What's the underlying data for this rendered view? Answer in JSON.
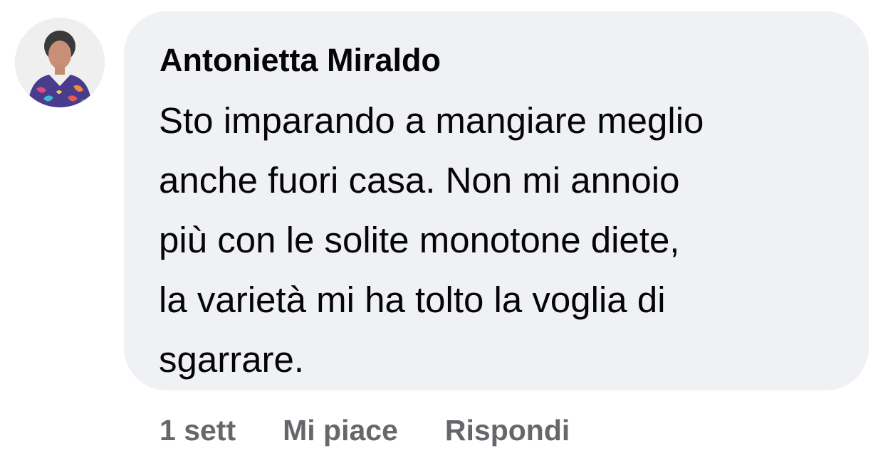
{
  "comment": {
    "author": "Antonietta Miraldo",
    "avatar_icon": "profile-photo-icon",
    "text_lines": [
      "Sto imparando a mangiare meglio",
      "anche fuori casa. Non mi annoio",
      "più con le solite monotone diete,",
      "la varietà mi ha tolto la voglia di",
      "sgarrare."
    ],
    "timestamp": "1 sett",
    "like_label": "Mi piace",
    "reply_label": "Rispondi"
  },
  "colors": {
    "bubble_bg": "#f0f1f4",
    "text": "#050505",
    "secondary_text": "#65676b"
  }
}
